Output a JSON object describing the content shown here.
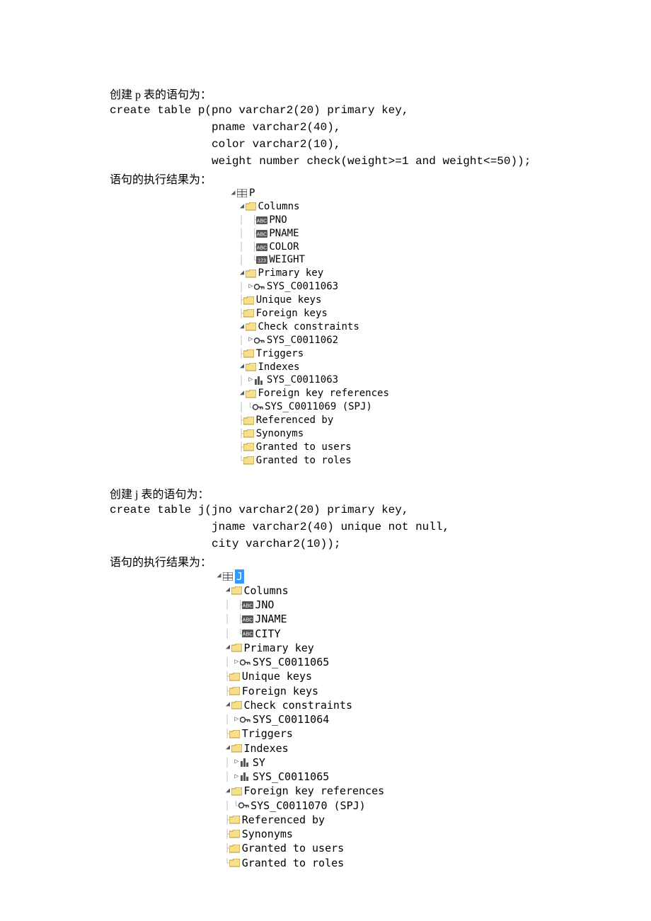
{
  "section_p": {
    "heading": "创建 p 表的语句为：",
    "code1": "create table p(pno varchar2(20) primary key,",
    "code2": "               pname varchar2(40),",
    "code3": "               color varchar2(10),",
    "code4": "               weight number check(weight>=1 and weight<=50));",
    "result_label": "语句的执行结果为：",
    "tree": {
      "root": "P",
      "columns_label": "Columns",
      "columns": [
        "PNO",
        "PNAME",
        "COLOR",
        "WEIGHT"
      ],
      "primary_key_label": "Primary key",
      "primary_key_item": "SYS_C0011063",
      "unique_keys_label": "Unique keys",
      "foreign_keys_label": "Foreign keys",
      "check_label": "Check constraints",
      "check_item": "SYS_C0011062",
      "triggers_label": "Triggers",
      "indexes_label": "Indexes",
      "index_item": "SYS_C0011063",
      "fk_ref_label": "Foreign key references",
      "fk_ref_item": "SYS_C0011069  (SPJ)",
      "referenced_by_label": "Referenced by",
      "synonyms_label": "Synonyms",
      "granted_users_label": "Granted to users",
      "granted_roles_label": "Granted to roles"
    }
  },
  "section_j": {
    "heading": "创建 j 表的语句为：",
    "code1": "create table j(jno varchar2(20) primary key,",
    "code2": "               jname varchar2(40) unique not null,",
    "code3": "               city varchar2(10));",
    "result_label": "语句的执行结果为：",
    "tree": {
      "root": "J",
      "columns_label": "Columns",
      "columns": [
        "JNO",
        "JNAME",
        "CITY"
      ],
      "primary_key_label": "Primary key",
      "primary_key_item": "SYS_C0011065",
      "unique_keys_label": "Unique keys",
      "foreign_keys_label": "Foreign keys",
      "check_label": "Check constraints",
      "check_item": "SYS_C0011064",
      "triggers_label": "Triggers",
      "indexes_label": "Indexes",
      "index_items": [
        "SY",
        "SYS_C0011065"
      ],
      "fk_ref_label": "Foreign key references",
      "fk_ref_item": "SYS_C0011070  (SPJ)",
      "referenced_by_label": "Referenced by",
      "synonyms_label": "Synonyms",
      "granted_users_label": "Granted to users",
      "granted_roles_label": "Granted to roles"
    }
  }
}
